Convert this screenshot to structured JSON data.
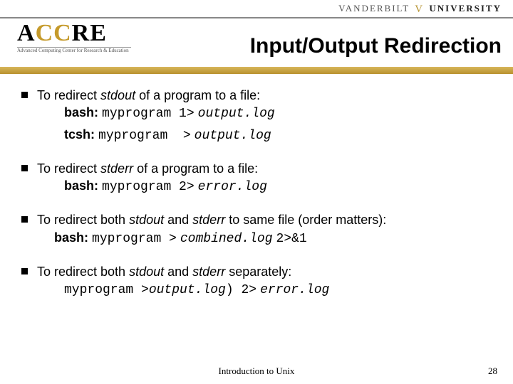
{
  "header": {
    "university_html": "VANDERBILT <span class='vstar'>V</span> <b>UNIVERSITY</b>",
    "accre_name": "ACCRE",
    "accre_sub": "Advanced Computing Center for Research & Education",
    "title": "Input/Output Redirection"
  },
  "bullets": [
    {
      "intro_html": "To redirect <i class='term'>stdout</i> of a program to a file:",
      "lines": [
        "<b class='sh'>bash:</b> <span class='mono'>myprogram 1&gt;</span> <span class='mono-i'>output.log</span>",
        "<b class='sh'>tcsh:</b> <span class='mono'>myprogram &nbsp;&gt;</span> <span class='mono-i'>output.log</span>"
      ]
    },
    {
      "intro_html": "To redirect <i class='term'>stderr</i> of a program to a file:",
      "lines": [
        "<b class='sh'>bash:</b> <span class='mono'>myprogram 2&gt;</span> <span class='mono-i'>error.log</span>"
      ]
    },
    {
      "intro_html": "To redirect both <i class='term'>stdout</i> and <i class='term'>stderr</i> to same file (order matters):",
      "lines": [
        "<b class='sh'>bash:</b> <span class='mono'>myprogram &gt;</span> <span class='mono-i'>combined.log</span> <span class='mono'>2&gt;&amp;1</span>"
      ]
    },
    {
      "intro_html": "To redirect both <i class='term'>stdout</i> and <i class='term'>stderr</i> separately:",
      "lines": [
        "<span class='mono'>myprogram &gt;</span><span class='mono-i'>output.log</span><span class='mono'>) 2&gt;</span> <span class='mono-i'>error.log</span>"
      ]
    }
  ],
  "footer": {
    "text": "Introduction to Unix",
    "page": "28"
  }
}
